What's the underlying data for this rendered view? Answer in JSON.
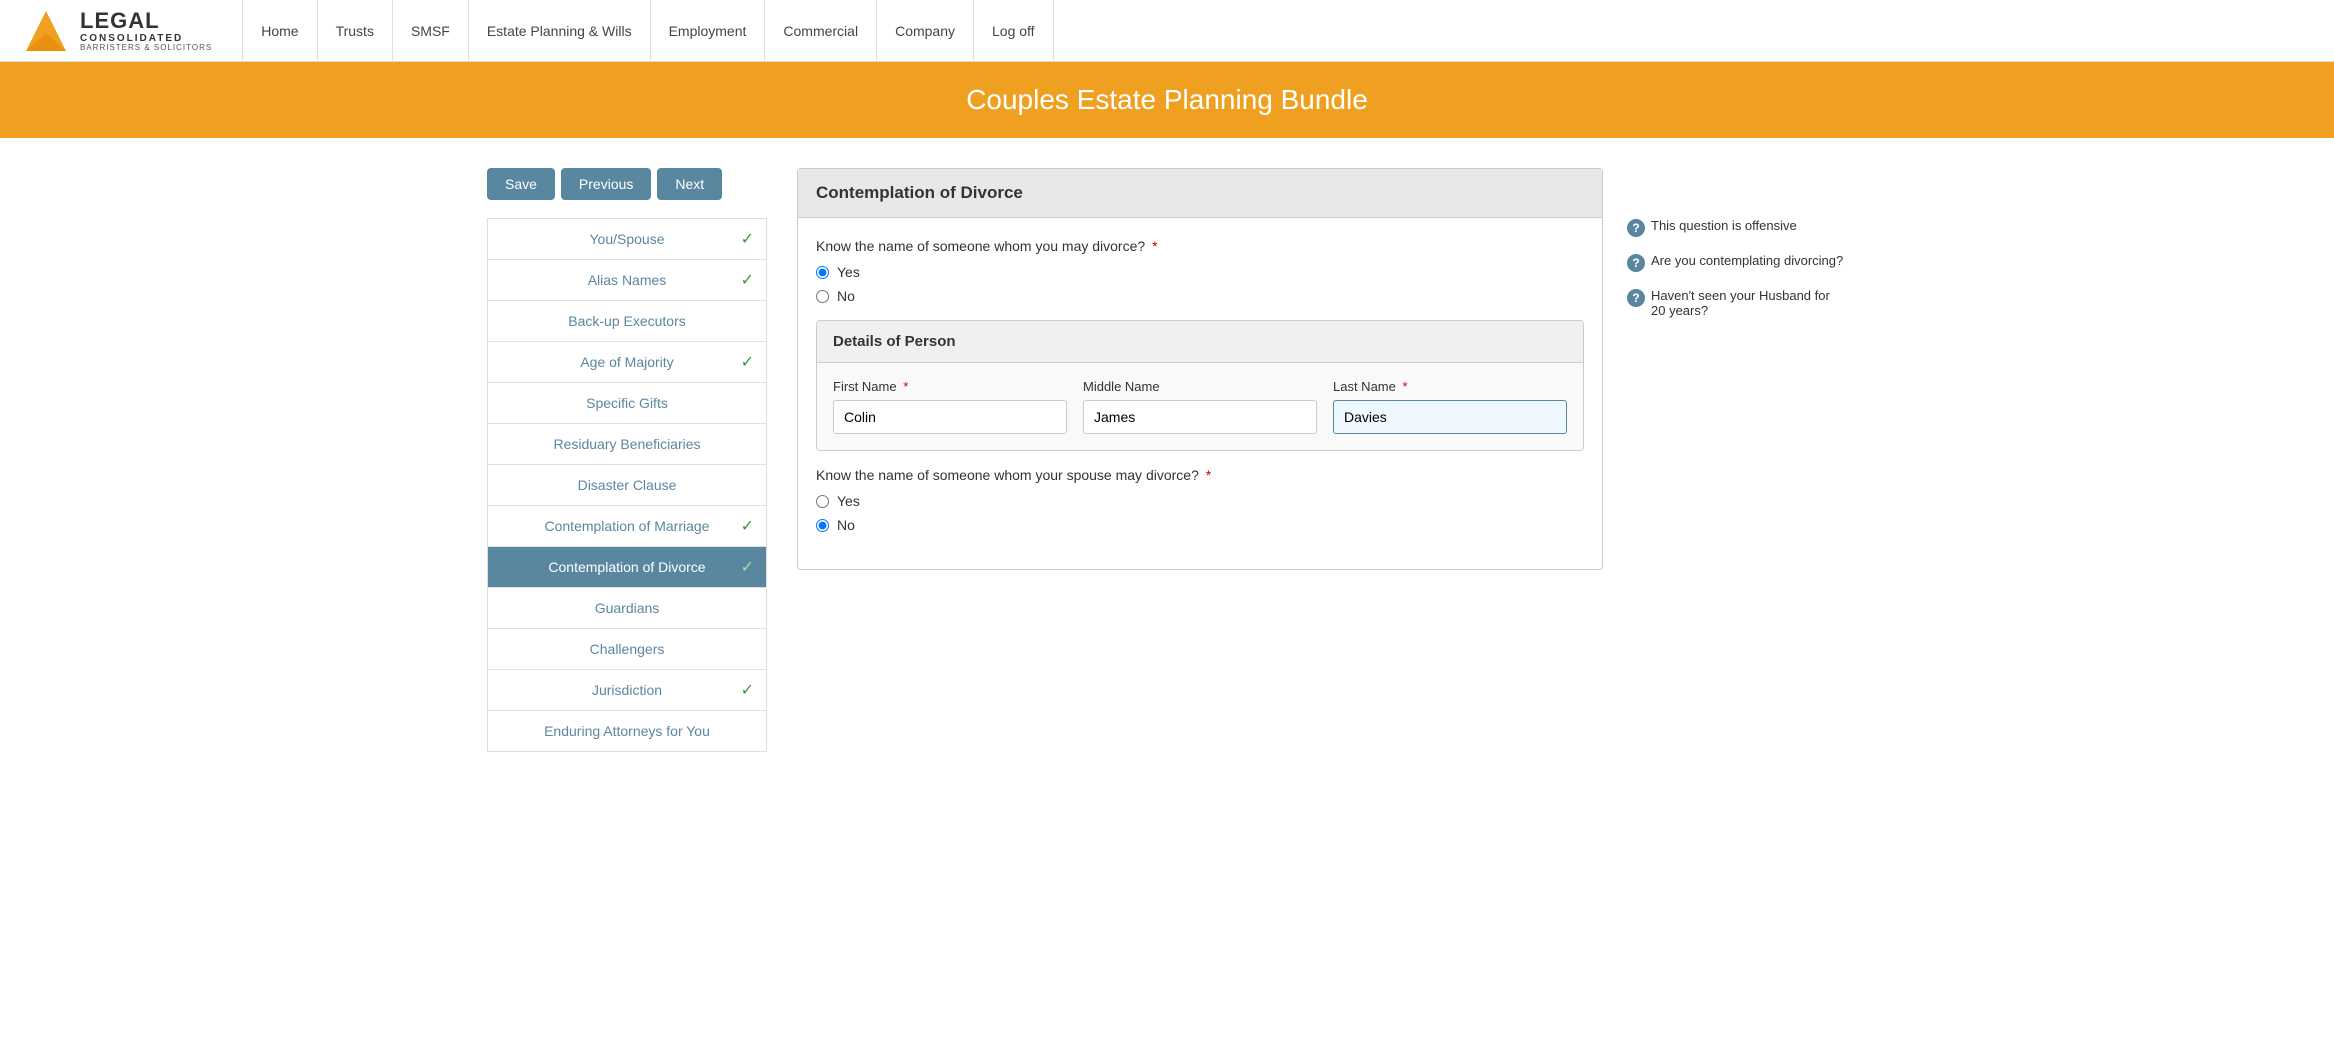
{
  "app": {
    "title": "Couples Estate Planning Bundle"
  },
  "navbar": {
    "logo_legal": "LEGAL",
    "logo_consolidated": "CONSOLIDATED",
    "logo_sub": "BARRISTERS & SOLICITORS",
    "links": [
      {
        "id": "home",
        "label": "Home"
      },
      {
        "id": "trusts",
        "label": "Trusts"
      },
      {
        "id": "smsf",
        "label": "SMSF"
      },
      {
        "id": "estate-planning-wills",
        "label": "Estate Planning & Wills"
      },
      {
        "id": "employment",
        "label": "Employment"
      },
      {
        "id": "commercial",
        "label": "Commercial"
      },
      {
        "id": "company",
        "label": "Company"
      },
      {
        "id": "log-off",
        "label": "Log off"
      }
    ]
  },
  "header": {
    "title": "Couples Estate Planning Bundle"
  },
  "buttons": {
    "save": "Save",
    "previous": "Previous",
    "next": "Next"
  },
  "sidebar": {
    "items": [
      {
        "id": "you-spouse",
        "label": "You/Spouse",
        "checked": true,
        "active": false
      },
      {
        "id": "alias-names",
        "label": "Alias Names",
        "checked": true,
        "active": false
      },
      {
        "id": "back-up-executors",
        "label": "Back-up Executors",
        "checked": false,
        "active": false
      },
      {
        "id": "age-of-majority",
        "label": "Age of Majority",
        "checked": true,
        "active": false
      },
      {
        "id": "specific-gifts",
        "label": "Specific Gifts",
        "checked": false,
        "active": false
      },
      {
        "id": "residuary-beneficiaries",
        "label": "Residuary Beneficiaries",
        "checked": false,
        "active": false
      },
      {
        "id": "disaster-clause",
        "label": "Disaster Clause",
        "checked": false,
        "active": false
      },
      {
        "id": "contemplation-of-marriage",
        "label": "Contemplation of Marriage",
        "checked": true,
        "active": false
      },
      {
        "id": "contemplation-of-divorce",
        "label": "Contemplation of Divorce",
        "checked": false,
        "active": true
      },
      {
        "id": "guardians",
        "label": "Guardians",
        "checked": false,
        "active": false
      },
      {
        "id": "challengers",
        "label": "Challengers",
        "checked": false,
        "active": false
      },
      {
        "id": "jurisdiction",
        "label": "Jurisdiction",
        "checked": true,
        "active": false
      },
      {
        "id": "enduring-attorneys-for-you",
        "label": "Enduring Attorneys for You",
        "checked": false,
        "active": false
      }
    ]
  },
  "form": {
    "section_title": "Contemplation of Divorce",
    "question1_label": "Know the name of someone whom you may divorce?",
    "question1_yes": "Yes",
    "question1_no": "No",
    "question1_value": "yes",
    "details_section_title": "Details of Person",
    "first_name_label": "First Name",
    "middle_name_label": "Middle Name",
    "last_name_label": "Last Name",
    "first_name_value": "Colin",
    "middle_name_value": "James",
    "last_name_value": "Davies",
    "question2_label": "Know the name of someone whom your spouse may divorce?",
    "question2_yes": "Yes",
    "question2_no": "No",
    "question2_value": "no"
  },
  "help": {
    "items": [
      {
        "id": "offensive",
        "text": "This question is offensive"
      },
      {
        "id": "contemplating",
        "text": "Are you contemplating divorcing?"
      },
      {
        "id": "husband",
        "text": "Haven't seen your Husband for 20 years?"
      }
    ]
  }
}
